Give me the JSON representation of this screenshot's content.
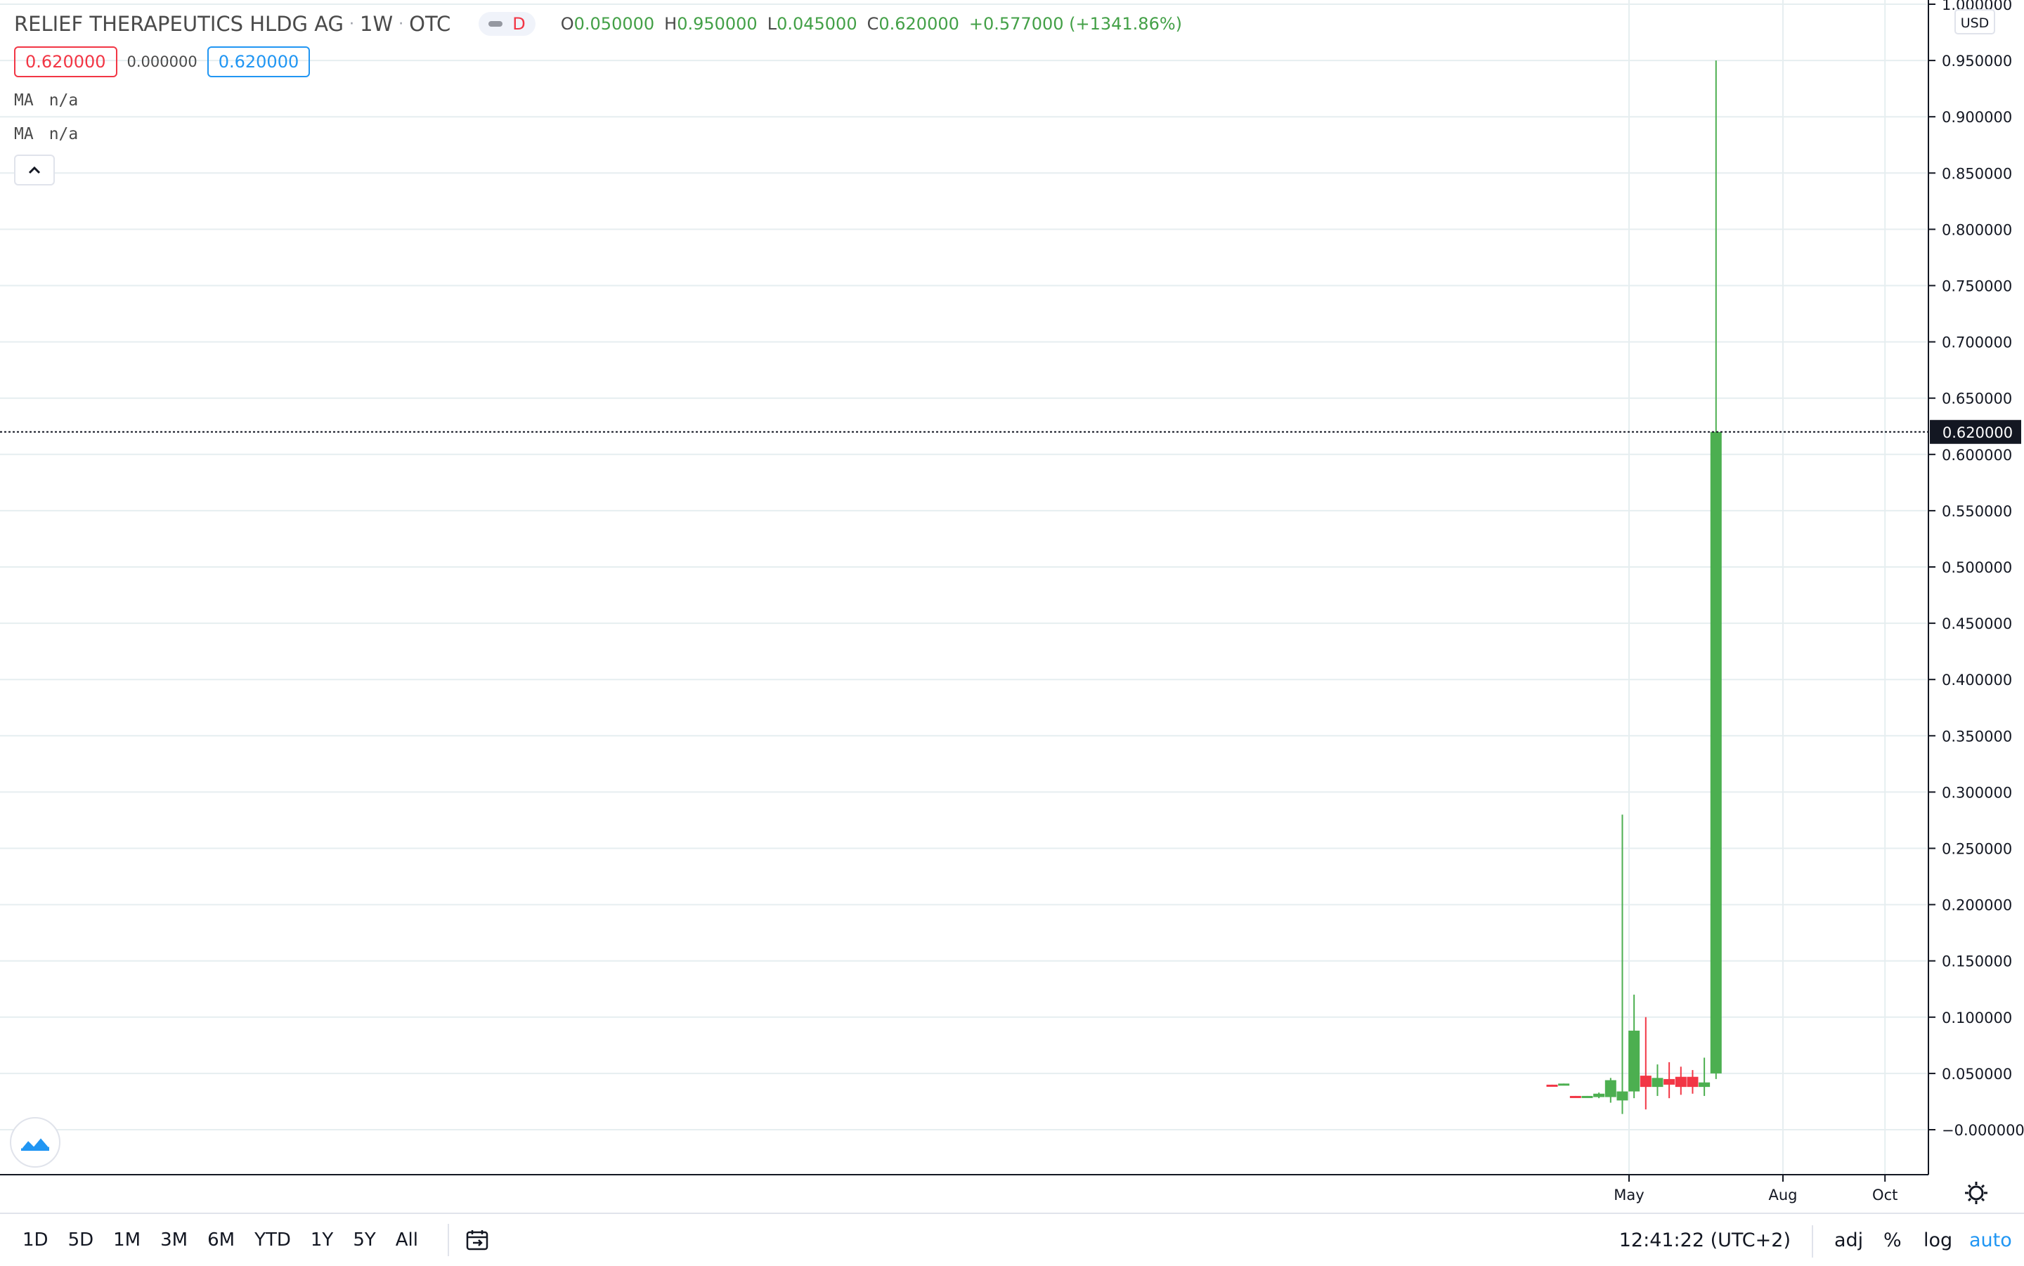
{
  "symbol": {
    "name": "RELIEF THERAPEUTICS HLDG AG",
    "interval": "1W",
    "exchange": "OTC",
    "badge": "D",
    "ohlc": {
      "o_label": "O",
      "o": "0.050000",
      "h_label": "H",
      "h": "0.950000",
      "l_label": "L",
      "l": "0.045000",
      "c_label": "C",
      "c": "0.620000",
      "change": "+0.577000 (+1341.86%)"
    },
    "bid": "0.620000",
    "spread": "0.000000",
    "ask": "0.620000"
  },
  "indicators": [
    {
      "name": "MA",
      "value": "n/a"
    },
    {
      "name": "MA",
      "value": "n/a"
    }
  ],
  "colors": {
    "up": "#4caf50",
    "down": "#f23645",
    "accent": "#2196f3",
    "grid": "#e6eef0",
    "axis_text": "#131722"
  },
  "price_axis": {
    "currency": "USD",
    "last_price_label": "0.620000",
    "ticks": [
      "1.000000",
      "0.950000",
      "0.900000",
      "0.850000",
      "0.800000",
      "0.750000",
      "0.700000",
      "0.650000",
      "0.600000",
      "0.550000",
      "0.500000",
      "0.450000",
      "0.400000",
      "0.350000",
      "0.300000",
      "0.250000",
      "0.200000",
      "0.150000",
      "0.100000",
      "0.050000",
      "−0.000000"
    ]
  },
  "time_axis": {
    "labels": [
      "May",
      "Aug",
      "Oct"
    ]
  },
  "bottom_bar": {
    "ranges": [
      "1D",
      "5D",
      "1M",
      "3M",
      "6M",
      "YTD",
      "1Y",
      "5Y",
      "All"
    ],
    "clock": "12:41:22 (UTC+2)",
    "adj": "adj",
    "percent": "%",
    "log": "log",
    "auto": "auto"
  },
  "chart_data": {
    "type": "candlestick",
    "interval": "1W",
    "ylim": [
      -0.02,
      1.0
    ],
    "x_ticks": [
      {
        "label": "May",
        "date": "2020-05-01"
      },
      {
        "label": "Aug",
        "date": "2020-08-01"
      },
      {
        "label": "Oct",
        "date": "2020-10-01"
      }
    ],
    "candles": [
      {
        "date": "2020-03-16",
        "open": 0.04,
        "high": 0.04,
        "low": 0.039,
        "close": 0.039
      },
      {
        "date": "2020-03-23",
        "open": 0.04,
        "high": 0.041,
        "low": 0.04,
        "close": 0.041
      },
      {
        "date": "2020-03-30",
        "open": 0.03,
        "high": 0.03,
        "low": 0.029,
        "close": 0.029
      },
      {
        "date": "2020-04-06",
        "open": 0.029,
        "high": 0.03,
        "low": 0.029,
        "close": 0.03
      },
      {
        "date": "2020-04-13",
        "open": 0.029,
        "high": 0.033,
        "low": 0.028,
        "close": 0.032
      },
      {
        "date": "2020-04-20",
        "open": 0.029,
        "high": 0.046,
        "low": 0.024,
        "close": 0.044
      },
      {
        "date": "2020-04-27",
        "open": 0.026,
        "high": 0.28,
        "low": 0.014,
        "close": 0.034
      },
      {
        "date": "2020-05-04",
        "open": 0.034,
        "high": 0.12,
        "low": 0.028,
        "close": 0.088
      },
      {
        "date": "2020-05-11",
        "open": 0.048,
        "high": 0.1,
        "low": 0.018,
        "close": 0.038
      },
      {
        "date": "2020-05-18",
        "open": 0.038,
        "high": 0.058,
        "low": 0.03,
        "close": 0.046
      },
      {
        "date": "2020-05-25",
        "open": 0.045,
        "high": 0.06,
        "low": 0.028,
        "close": 0.04
      },
      {
        "date": "2020-06-01",
        "open": 0.047,
        "high": 0.056,
        "low": 0.031,
        "close": 0.038
      },
      {
        "date": "2020-06-08",
        "open": 0.047,
        "high": 0.053,
        "low": 0.032,
        "close": 0.038
      },
      {
        "date": "2020-06-15",
        "open": 0.038,
        "high": 0.064,
        "low": 0.03,
        "close": 0.042
      },
      {
        "date": "2020-06-22",
        "open": 0.05,
        "high": 0.95,
        "low": 0.045,
        "close": 0.62
      }
    ]
  }
}
